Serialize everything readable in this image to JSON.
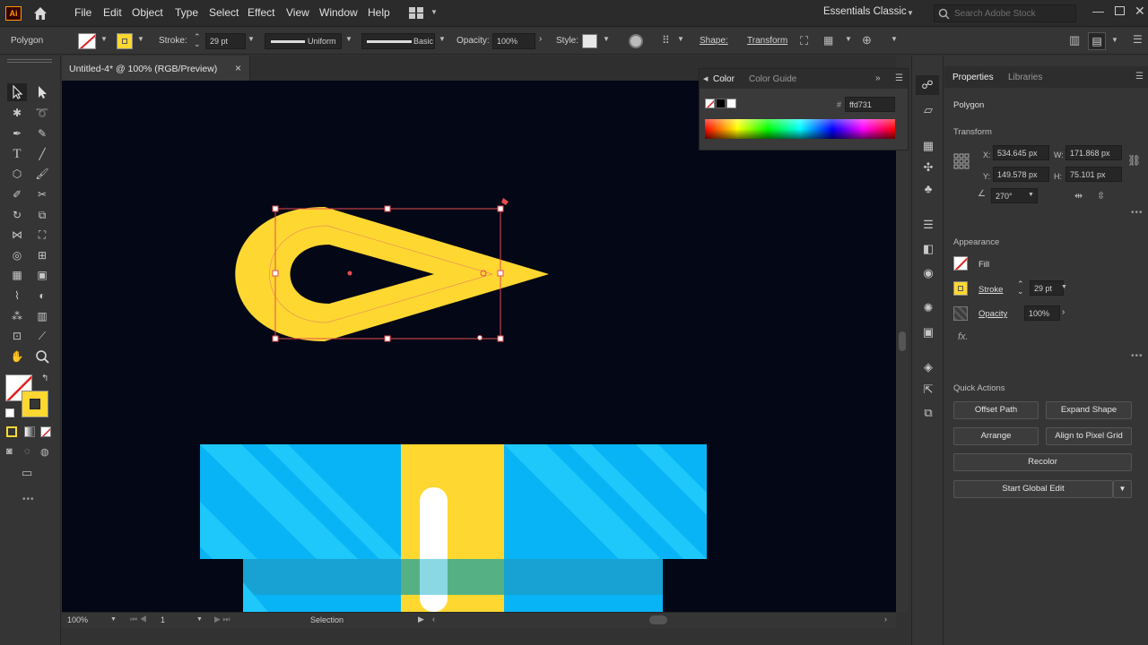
{
  "app": {
    "logo": "Ai",
    "workspace": "Essentials Classic",
    "search_placeholder": "Search Adobe Stock"
  },
  "menu": [
    "File",
    "Edit",
    "Object",
    "Type",
    "Select",
    "Effect",
    "View",
    "Window",
    "Help"
  ],
  "control": {
    "object_type": "Polygon",
    "stroke_label": "Stroke:",
    "stroke_weight": "29 pt",
    "profile": "Uniform",
    "brush": "Basic",
    "opacity_label": "Opacity:",
    "opacity": "100%",
    "style_label": "Style:",
    "shape_label": "Shape:",
    "transform_label": "Transform",
    "fill_color": "#ffd731"
  },
  "document": {
    "tab_title": "Untitled-4* @ 100% (RGB/Preview)",
    "close": "×"
  },
  "status": {
    "zoom": "100%",
    "artboard": "1",
    "tool": "Selection"
  },
  "color_panel": {
    "tab_color": "Color",
    "tab_guide": "Color Guide",
    "hash": "#",
    "hex": "ffd731"
  },
  "properties": {
    "tab_properties": "Properties",
    "tab_libraries": "Libraries",
    "object": "Polygon",
    "transform_title": "Transform",
    "x_label": "X:",
    "x": "534.645 px",
    "y_label": "Y:",
    "y": "149.578 px",
    "w_label": "W:",
    "w": "171.868 px",
    "h_label": "H:",
    "h": "75.101 px",
    "angle": "270°",
    "appearance_title": "Appearance",
    "fill_label": "Fill",
    "stroke_label": "Stroke",
    "stroke_weight": "29 pt",
    "opacity_label": "Opacity",
    "opacity": "100%",
    "fx": "fx.",
    "quick_actions_title": "Quick Actions",
    "btn_offset": "Offset Path",
    "btn_expand": "Expand Shape",
    "btn_arrange": "Arrange",
    "btn_align": "Align to Pixel Grid",
    "btn_recolor": "Recolor",
    "btn_global": "Start Global Edit"
  },
  "colors": {
    "yellow": "#ffd731",
    "cyan_light": "#1ec8fb",
    "cyan": "#08b4f5",
    "canvas": "#030716",
    "selection": "#e64c4c"
  }
}
